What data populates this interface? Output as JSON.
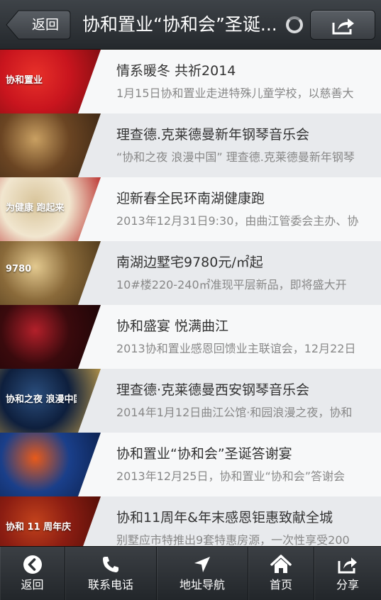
{
  "header": {
    "back_label": "返回",
    "title": "协和置业“协和会”圣诞...",
    "share_icon": "share-icon"
  },
  "list": [
    {
      "title": "情系暖冬 共祈2014",
      "desc": "1月15日协和置业走进特殊儿童学校，以慈善大",
      "thumb_text": "协和置业",
      "colors": [
        "#c9151e",
        "#e8312a",
        "#7a0d10"
      ]
    },
    {
      "title": "理查德.克莱德曼新年钢琴音乐会",
      "desc": "“协和之夜 浪漫中国” 理查德.克莱德曼新年钢琴",
      "thumb_text": "",
      "colors": [
        "#6b4523",
        "#c9a062",
        "#3a2614"
      ]
    },
    {
      "title": "迎新春全民环南湖健康跑",
      "desc": "2013年12月31日9:30，由曲江管委会主办、协",
      "thumb_text": "为健康 跑起来",
      "colors": [
        "#f1e6cf",
        "#d8c49a",
        "#b51d1d"
      ]
    },
    {
      "title": "南湖边墅宅9780元/㎡起",
      "desc": "10#楼220-240㎡准现平层新品，即将盛大开",
      "thumb_text": "9780",
      "colors": [
        "#8a6a3a",
        "#e3c98f",
        "#4a3518"
      ]
    },
    {
      "title": "协和盛宴 悦满曲江",
      "desc": "2013协和置业感恩回馈业主联谊会，12月22日",
      "thumb_text": "",
      "colors": [
        "#3a0a0d",
        "#b3202a",
        "#1a0506"
      ]
    },
    {
      "title": "理查德·克莱德曼西安钢琴音乐会",
      "desc": "2014年1月12日曲江公馆·和园浪漫之夜，协和",
      "thumb_text": "协和之夜 浪漫中国",
      "colors": [
        "#0e1f3d",
        "#2a4d7c",
        "#c7a14a"
      ]
    },
    {
      "title": "协和置业“协和会”圣诞答谢宴",
      "desc": "2013年12月25日，协和置业“协和会”答谢会",
      "thumb_text": "",
      "colors": [
        "#1a3f8a",
        "#e85a1a",
        "#0b1f4a"
      ]
    },
    {
      "title": "协和11周年&年末感恩钜惠致献全城",
      "desc": "别墅应市特推出9套特惠房源，一次性享受200",
      "thumb_text": "协和 11 周年庆",
      "colors": [
        "#8b1d12",
        "#c2421c",
        "#4d0d07"
      ]
    }
  ],
  "toolbar": [
    {
      "label": "返回",
      "icon": "back-circle-icon"
    },
    {
      "label": "联系电话",
      "icon": "phone-icon"
    },
    {
      "label": "地址导航",
      "icon": "navigation-arrow-icon"
    },
    {
      "label": "首页",
      "icon": "home-icon"
    },
    {
      "label": "分享",
      "icon": "share-icon"
    }
  ]
}
